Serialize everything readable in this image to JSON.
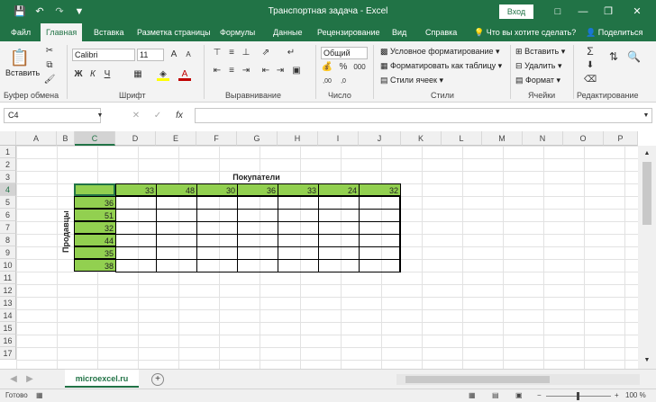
{
  "titlebar": {
    "title": "Транспортная задача  -  Excel",
    "login": "Вход"
  },
  "tabs": [
    "Файл",
    "Главная",
    "Вставка",
    "Разметка страницы",
    "Формулы",
    "Данные",
    "Рецензирование",
    "Вид",
    "Справка"
  ],
  "tell_me": "Что вы хотите сделать?",
  "share": "Поделиться",
  "ribbon": {
    "paste": "Вставить",
    "clipboard": "Буфер обмена",
    "font_name": "Calibri",
    "font_size": "11",
    "font_group": "Шрифт",
    "align_group": "Выравнивание",
    "number_format": "Общий",
    "number_group": "Число",
    "cond_format": "Условное форматирование",
    "format_table": "Форматировать как таблицу",
    "cell_styles": "Стили ячеек",
    "styles_group": "Стили",
    "insert": "Вставить",
    "delete": "Удалить",
    "format": "Формат",
    "cells_group": "Ячейки",
    "editing_group": "Редактирование"
  },
  "formula_bar": {
    "name_box": "C4",
    "fx": "fx"
  },
  "columns": [
    "A",
    "B",
    "C",
    "D",
    "E",
    "F",
    "G",
    "H",
    "I",
    "J",
    "K",
    "L",
    "M",
    "N",
    "O",
    "P"
  ],
  "rows": [
    "1",
    "2",
    "3",
    "4",
    "5",
    "6",
    "7",
    "8",
    "9",
    "10",
    "11",
    "12",
    "13",
    "14",
    "15",
    "16",
    "17"
  ],
  "sheet": {
    "buyers_label": "Покупатели",
    "sellers_label": "Продавцы",
    "buyers": [
      "33",
      "48",
      "30",
      "36",
      "33",
      "24",
      "32"
    ],
    "sellers": [
      "36",
      "51",
      "32",
      "44",
      "35",
      "38"
    ]
  },
  "sheet_tab": "microexcel.ru",
  "status": {
    "ready": "Готово",
    "zoom": "100 %"
  }
}
